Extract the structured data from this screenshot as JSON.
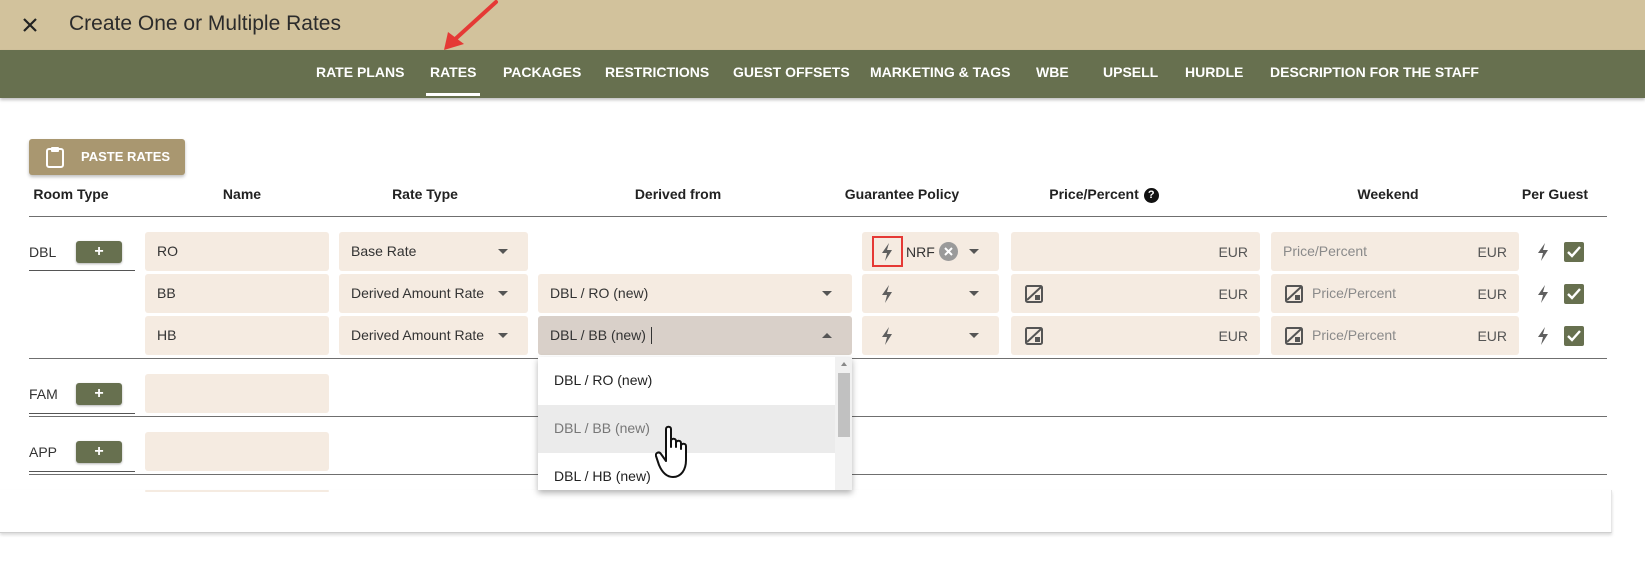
{
  "window": {
    "title": "Create One or Multiple Rates"
  },
  "tabs": [
    "RATE PLANS",
    "RATES",
    "PACKAGES",
    "RESTRICTIONS",
    "GUEST OFFSETS",
    "MARKETING & TAGS",
    "WBE",
    "UPSELL",
    "HURDLE",
    "DESCRIPTION FOR THE STAFF"
  ],
  "active_tab": "RATES",
  "toolbar": {
    "paste_label": "PASTE RATES"
  },
  "columns": [
    "Room Type",
    "Name",
    "Rate Type",
    "Derived from",
    "Guarantee Policy",
    "Price/Percent",
    "Weekend",
    "Per Guest"
  ],
  "plus_label": "+",
  "currency": "EUR",
  "price_placeholder": "Price/Percent",
  "help_glyph": "?",
  "rooms": [
    {
      "type": "DBL",
      "rates": [
        {
          "name": "RO",
          "rate_type": "Base Rate",
          "derived_from": "",
          "guarantee": "NRF",
          "per_guest": true
        },
        {
          "name": "BB",
          "rate_type": "Derived Amount Rate",
          "derived_from": "DBL / RO (new)",
          "guarantee": "",
          "per_guest": true
        },
        {
          "name": "HB",
          "rate_type": "Derived Amount Rate",
          "derived_from": "DBL / BB (new)",
          "guarantee": "",
          "per_guest": true
        }
      ]
    },
    {
      "type": "FAM",
      "rates": []
    },
    {
      "type": "APP",
      "rates": []
    }
  ],
  "dropdown": {
    "options": [
      "DBL / RO (new)",
      "DBL / BB (new)",
      "DBL / HB (new)"
    ],
    "highlighted": "DBL / BB (new)"
  },
  "colors": {
    "titlebar": "#d2c29c",
    "tabbar": "#67704f",
    "field": "#f5ebe1",
    "paste_button": "#a99770",
    "annotation": "#e53935"
  }
}
